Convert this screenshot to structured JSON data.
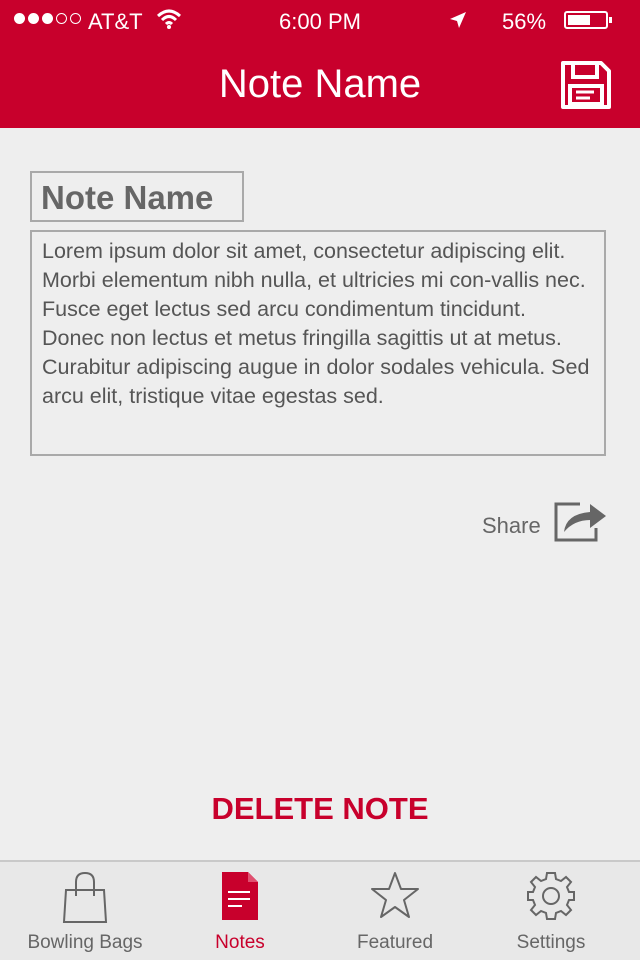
{
  "status_bar": {
    "carrier": "AT&T",
    "time": "6:00 PM",
    "battery_percent": "56%",
    "signal_bars_filled": 3,
    "signal_bars_total": 5
  },
  "nav": {
    "title": "Note Name",
    "save_icon": "floppy-disk-icon"
  },
  "note": {
    "name": "Note Name",
    "body": "Lorem ipsum dolor sit amet, consectetur adipiscing elit. Morbi elementum nibh nulla, et ultricies mi con-vallis nec. Fusce eget lectus sed arcu condimentum tincidunt. Donec non lectus et metus fringilla sagittis ut at metus. Curabitur adipiscing augue in dolor sodales vehicula. Sed arcu elit, tristique vitae egestas sed."
  },
  "share": {
    "label": "Share",
    "icon": "share-arrow-icon"
  },
  "delete_label": "DELETE NOTE",
  "tabs": [
    {
      "label": "Bowling Bags",
      "icon": "bag-icon",
      "active": false
    },
    {
      "label": "Notes",
      "icon": "document-icon",
      "active": true
    },
    {
      "label": "Featured",
      "icon": "star-icon",
      "active": false
    },
    {
      "label": "Settings",
      "icon": "gear-icon",
      "active": false
    }
  ],
  "colors": {
    "accent": "#c8002c",
    "background": "#eeeeee",
    "tab_inactive": "#666666"
  }
}
